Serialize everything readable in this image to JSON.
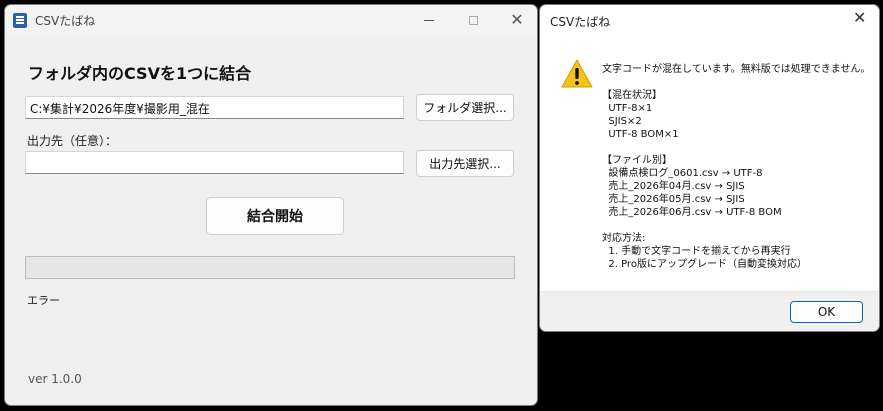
{
  "main_window": {
    "title": "CSVたばね",
    "heading": "フォルダ内のCSVを1つに結合",
    "folder_path": "C:¥集計¥2026年度¥撮影用_混在",
    "folder_button": "フォルダ選択...",
    "output_label": "出力先（任意）：",
    "output_value": "",
    "output_button": "出力先選択...",
    "start_button": "結合開始",
    "progress_percent": 0,
    "status": "エラー",
    "version": "ver 1.0.0"
  },
  "dialog": {
    "title": "CSVたばね",
    "icon": "warning-icon",
    "message": "文字コードが混在しています。無料版では処理できません。\n\n【混在状況】\n  UTF-8×1\n  SJIS×2\n  UTF-8 BOM×1\n\n【ファイル別】\n  設備点検ログ_0601.csv → UTF-8\n  売上_2026年04月.csv → SJIS\n  売上_2026年05月.csv → SJIS\n  売上_2026年06月.csv → UTF-8 BOM\n\n対応方法:\n  1. 手動で文字コードを揃えてから再実行\n  2. Pro版にアップグレード（自動変換対応）",
    "ok_button": "OK"
  },
  "colors": {
    "warning_yellow": "#f8c318",
    "ok_border": "#0067c0"
  }
}
